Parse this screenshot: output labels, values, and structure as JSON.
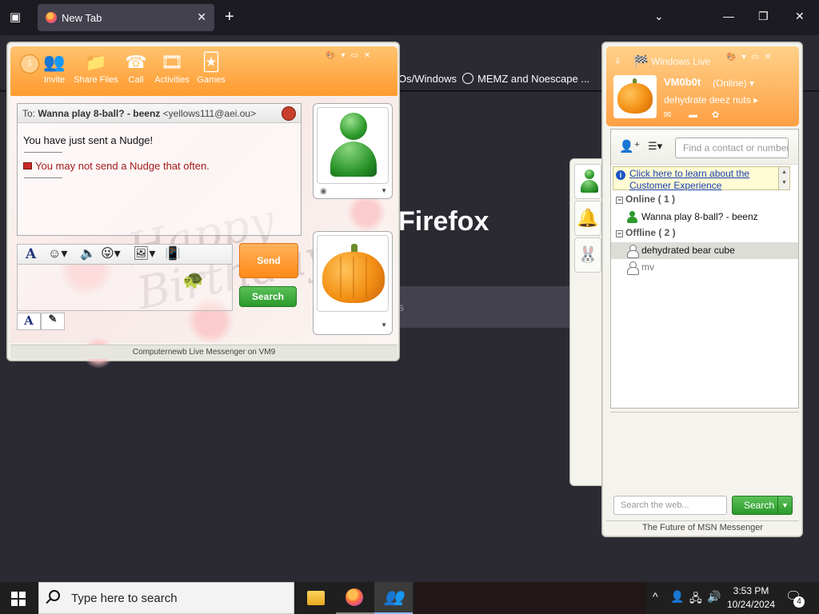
{
  "firefox": {
    "tab_title": "New Tab",
    "brand": "Firefox",
    "bookmarks": [
      "Os/Windows",
      "MEMZ and Noescape ..."
    ],
    "search_hint": "s"
  },
  "conversation": {
    "toolbar": [
      "Invite",
      "Share Files",
      "Call",
      "Activities",
      "Games"
    ],
    "to_label": "To:",
    "contact_name": "Wanna play 8-ball? - beenz",
    "contact_email": "<yellows111@aei.ou>",
    "messages": [
      "You have just sent a Nudge!",
      "You may not send a Nudge that often."
    ],
    "background_text": "Happy Birthday",
    "send_label": "Send",
    "search_label": "Search",
    "status_bar": "Computernewb Live Messenger on VM9"
  },
  "contact_list": {
    "title": "Windows Live",
    "user_name": "VM0b0t",
    "user_status": "(Online)",
    "personal_message": "dehydrate deez nuts",
    "find_placeholder": "Find a contact or number",
    "info_link": "Click here to learn about the Customer Experience",
    "groups": [
      {
        "label": "Online ( 1 )",
        "contacts": [
          "Wanna play 8-ball? - beenz"
        ]
      },
      {
        "label": "Offline ( 2 )",
        "contacts": [
          "dehydrated bear cube",
          "mv"
        ]
      }
    ],
    "web_search_placeholder": "Search the web...",
    "search_button": "Search",
    "status_bar": "The Future of MSN Messenger"
  },
  "taskbar": {
    "search_placeholder": "Type here to search",
    "time": "3:53 PM",
    "date": "10/24/2024",
    "notification_count": "4"
  },
  "colors": {
    "accent_orange": "#ff9a2e",
    "accent_green": "#2a9a2a",
    "firefox_bg": "#2b2a33"
  }
}
